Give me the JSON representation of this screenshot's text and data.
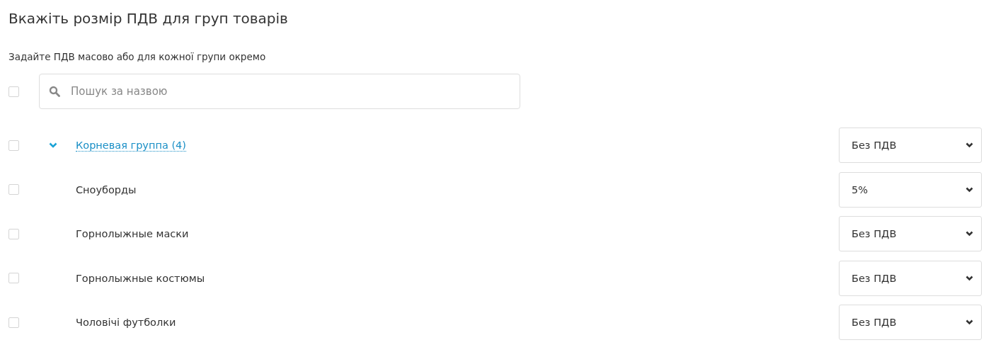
{
  "title": "Вкажіть розмір ПДВ для груп товарів",
  "subtitle": "Задайте ПДВ масово або для кожної групи окремо",
  "select_all": {
    "checked": false
  },
  "search": {
    "placeholder": "Пошук за назвою"
  },
  "groups": [
    {
      "name": "Корневая группа (4)",
      "checked": false,
      "expanded": true,
      "vat": "Без ПДВ",
      "children": [
        {
          "name": "Сноуборды",
          "checked": false,
          "vat": "5%"
        },
        {
          "name": "Горнолыжные маски",
          "checked": false,
          "vat": "Без ПДВ"
        },
        {
          "name": "Горнолыжные костюмы",
          "checked": false,
          "vat": "Без ПДВ"
        },
        {
          "name": "Чоловічі футболки",
          "checked": false,
          "vat": "Без ПДВ"
        }
      ]
    }
  ]
}
